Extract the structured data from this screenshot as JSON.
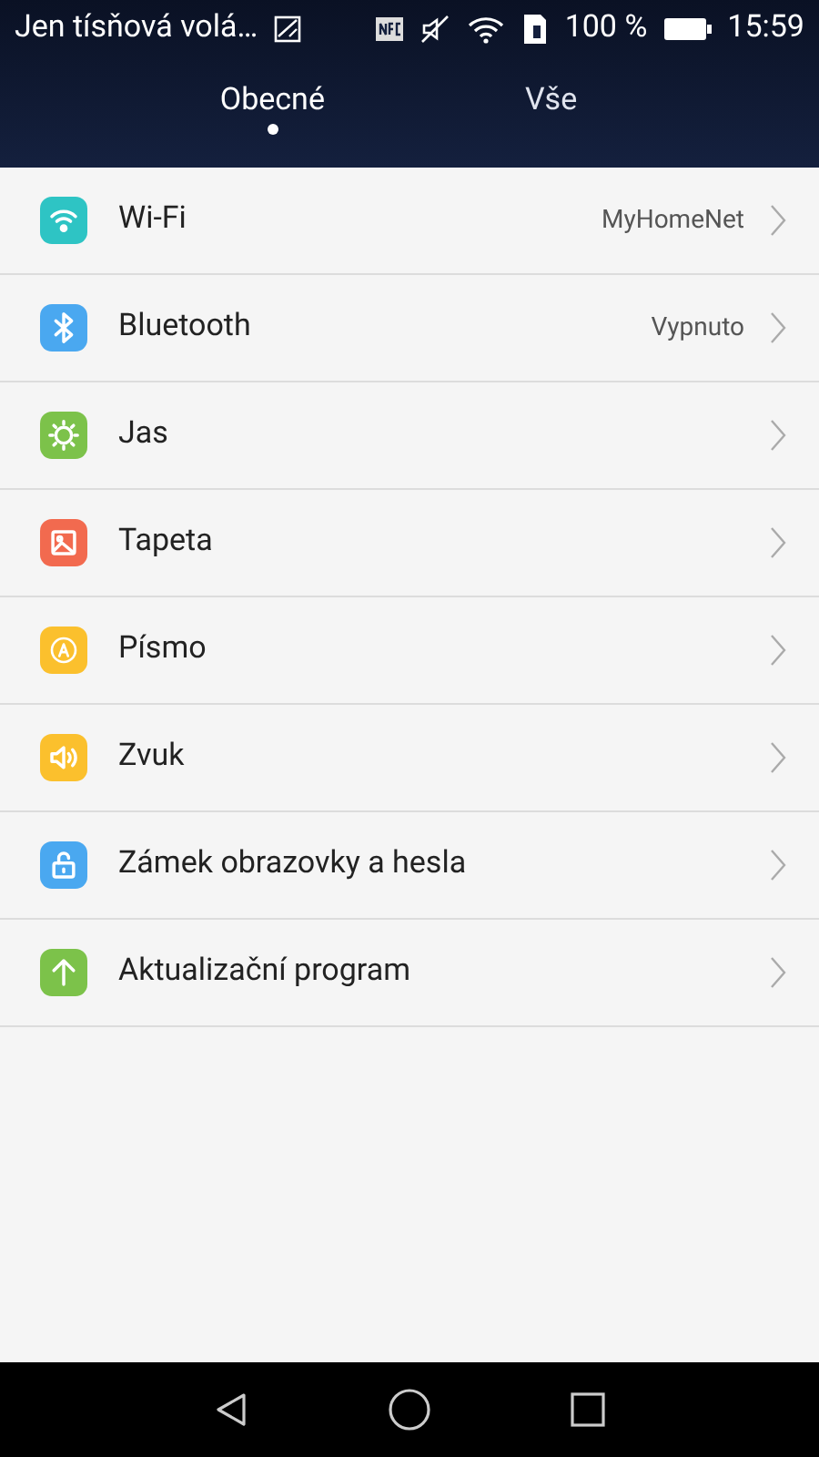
{
  "status_bar": {
    "carrier": "Jen tísňová volá…",
    "battery": "100 %",
    "time": "15:59"
  },
  "tabs": [
    {
      "label": "Obecné",
      "selected": true
    },
    {
      "label": "Vše",
      "selected": false
    }
  ],
  "settings": [
    {
      "label": "Wi-Fi",
      "value": "MyHomeNet",
      "color": "#2ec4c4"
    },
    {
      "label": "Bluetooth",
      "value": "Vypnuto",
      "color": "#4aa8f0"
    },
    {
      "label": "Jas",
      "color": "#7cc24a"
    },
    {
      "label": "Tapeta",
      "color": "#f26a4f"
    },
    {
      "label": "Písmo",
      "color": "#fbc02d"
    },
    {
      "label": "Zvuk",
      "color": "#fbc02d"
    },
    {
      "label": "Zámek obrazovky a hesla",
      "color": "#4aa8f0"
    },
    {
      "label": "Aktualizační program",
      "color": "#7cc24a"
    }
  ]
}
